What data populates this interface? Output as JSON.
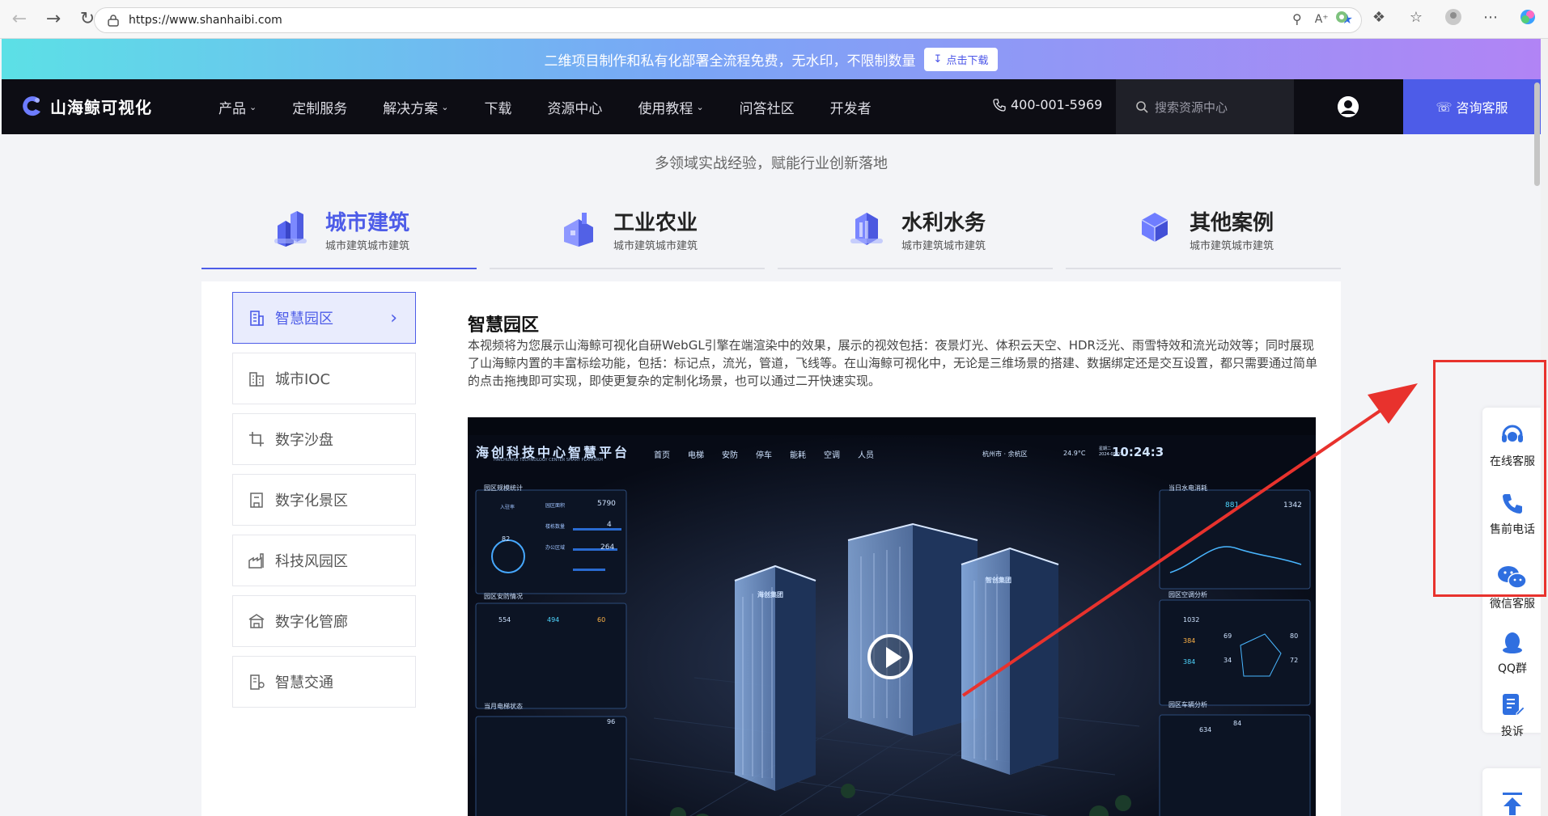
{
  "browser": {
    "url": "https://www.shanhaibi.com"
  },
  "promo": {
    "text": "二维项目制作和私有化部署全流程免费，无水印，不限制数量",
    "button": "点击下载"
  },
  "nav": {
    "logo": "山海鲸可视化",
    "items": [
      {
        "label": "产品",
        "dropdown": true
      },
      {
        "label": "定制服务",
        "dropdown": false
      },
      {
        "label": "解决方案",
        "dropdown": true
      },
      {
        "label": "下载",
        "dropdown": false
      },
      {
        "label": "资源中心",
        "dropdown": false
      },
      {
        "label": "使用教程",
        "dropdown": true
      },
      {
        "label": "问答社区",
        "dropdown": false
      },
      {
        "label": "开发者",
        "dropdown": false
      }
    ],
    "phone": "400-001-5969",
    "search_placeholder": "搜索资源中心",
    "consult": "咨询客服"
  },
  "hero": {
    "subtitle": "多领域实战经验，赋能行业创新落地"
  },
  "categories": [
    {
      "title": "城市建筑",
      "sub": "城市建筑城市建筑",
      "active": true
    },
    {
      "title": "工业农业",
      "sub": "城市建筑城市建筑",
      "active": false
    },
    {
      "title": "水利水务",
      "sub": "城市建筑城市建筑",
      "active": false
    },
    {
      "title": "其他案例",
      "sub": "城市建筑城市建筑",
      "active": false
    }
  ],
  "sidebar": [
    {
      "label": "智慧园区",
      "active": true,
      "icon": "building-icon"
    },
    {
      "label": "城市IOC",
      "active": false,
      "icon": "city-icon"
    },
    {
      "label": "数字沙盘",
      "active": false,
      "icon": "crop-icon"
    },
    {
      "label": "数字化景区",
      "active": false,
      "icon": "scenic-icon"
    },
    {
      "label": "科技风园区",
      "active": false,
      "icon": "factory-icon"
    },
    {
      "label": "数字化管廊",
      "active": false,
      "icon": "pipe-icon"
    },
    {
      "label": "智慧交通",
      "active": false,
      "icon": "traffic-icon"
    }
  ],
  "content": {
    "title": "智慧园区",
    "description": "本视频将为您展示山海鲸可视化自研WebGL引擎在端渲染中的效果，展示的视效包括：夜景灯光、体积云天空、HDR泛光、雨雪特效和流光动效等；同时展现了山海鲸内置的丰富标绘功能，包括：标记点，流光，管道，飞线等。在山海鲸可视化中，无论是三维场景的搭建、数据绑定还是交互设置，都只需要通过简单的点击拖拽即可实现，即使更复杂的定制化场景，也可以通过二开快速实现。"
  },
  "video": {
    "platform_title": "海创科技中心智慧平台",
    "platform_sub": "HAICHUANG TECHNOLOGY CENTER SMART PLATFORM",
    "tabs": [
      "首页",
      "电梯",
      "安防",
      "停车",
      "能耗",
      "空调",
      "人员"
    ],
    "location": "杭州市 · 余杭区",
    "temp": "24.9°C",
    "date": "星期二 2024-05-07",
    "time": "10:24:3",
    "panel_park": "园区规模统计",
    "park_area_label": "园区面积",
    "park_area": "5790",
    "building_label": "楼栋数量",
    "building": "4",
    "office_label": "办公区域",
    "office": "264",
    "occupancy_label": "入驻率",
    "occupancy": "82",
    "panel_security": "园区安防情况",
    "cam_total": "554",
    "cam_normal": "494",
    "cam_fault": "60",
    "panel_water": "当日水电消耗",
    "water": "881",
    "power": "1342",
    "panel_ac": "园区空调分析",
    "ac_total": "1032",
    "ac_on": "384",
    "ac_off": "384",
    "ac_r1": "69",
    "ac_r2": "34",
    "ac_r3": "80",
    "ac_r4": "72",
    "panel_elevator": "当月电梯状态",
    "elevator": "96",
    "panel_vehicle": "园区车辆分析",
    "vehicle_total": "634",
    "vehicle_pct": "84",
    "building_sign1": "海创集团",
    "building_sign2": "智创集团"
  },
  "float": {
    "items": [
      "在线客服",
      "售前电话",
      "微信客服",
      "QQ群",
      "投诉"
    ]
  },
  "colors": {
    "accent": "#4d5ce8",
    "nav_bg": "#0d0d14",
    "annotation": "#e8322d"
  }
}
